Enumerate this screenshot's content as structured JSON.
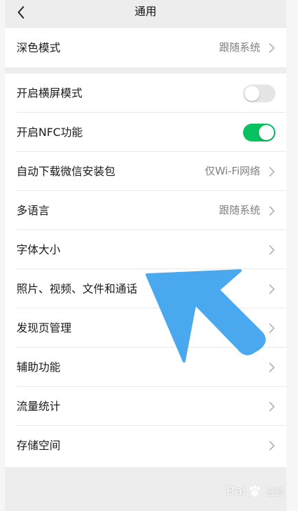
{
  "header": {
    "title": "通用",
    "back_icon": "chevron-left-icon"
  },
  "group1": {
    "dark_mode": {
      "label": "深色模式",
      "value": "跟随系统"
    }
  },
  "group2": {
    "landscape": {
      "label": "开启横屏模式",
      "enabled": false
    },
    "nfc": {
      "label": "开启NFC功能",
      "enabled": true
    },
    "auto_download": {
      "label": "自动下载微信安装包",
      "value": "仅Wi-Fi网络"
    },
    "language": {
      "label": "多语言",
      "value": "跟随系统"
    },
    "font_size": {
      "label": "字体大小"
    },
    "media": {
      "label": "照片、视频、文件和通话"
    },
    "discover": {
      "label": "发现页管理"
    },
    "accessibility": {
      "label": "辅助功能"
    },
    "data_usage": {
      "label": "流量统计"
    },
    "storage": {
      "label": "存储空间"
    }
  },
  "colors": {
    "toggle_on": "#07c160",
    "toggle_off": "#e5e5e5",
    "annotation_arrow": "#4aa8ee",
    "background": "#ededed"
  },
  "watermark": {
    "text_left": "Bai",
    "text_right": "经验",
    "logo_icon": "baidu-paw-icon"
  }
}
